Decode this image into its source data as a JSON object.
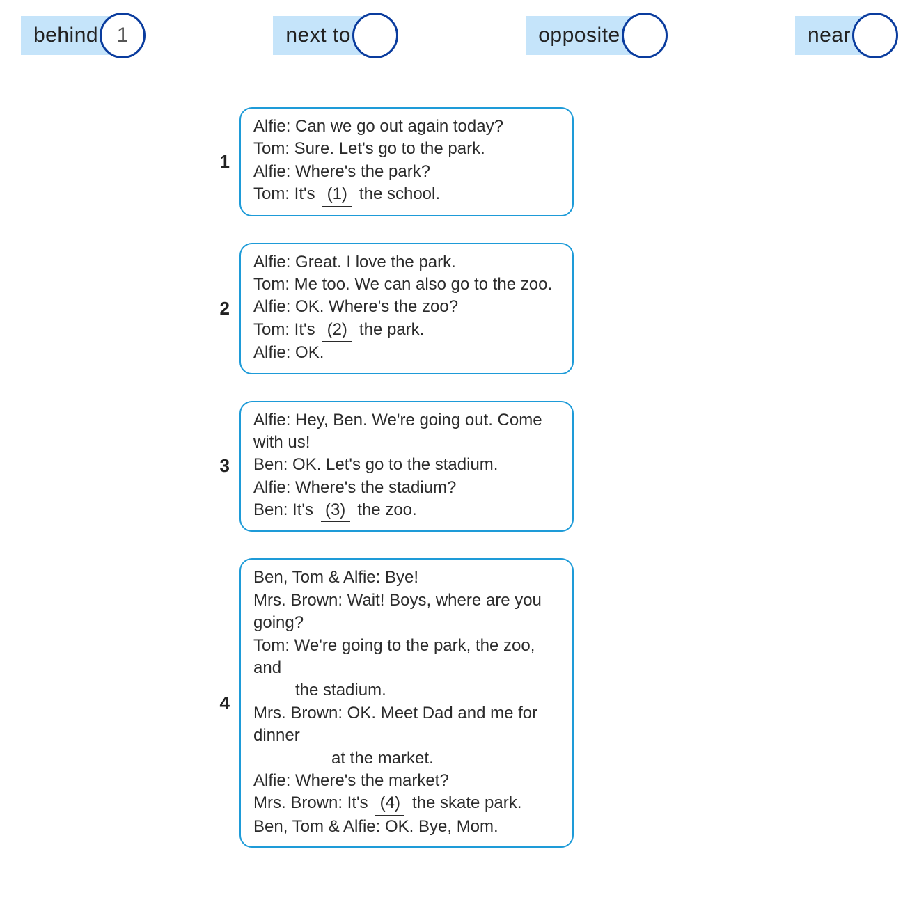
{
  "vocab": [
    {
      "label": "behind",
      "value": "1"
    },
    {
      "label": "next to",
      "value": ""
    },
    {
      "label": "opposite",
      "value": ""
    },
    {
      "label": "near",
      "value": ""
    }
  ],
  "dialogues": [
    {
      "num": "1",
      "lines": [
        {
          "t": "Alfie: Can we go out again today?"
        },
        {
          "t": "Tom: Sure. Let's go to the park."
        },
        {
          "t": "Alfie: Where's the park?"
        },
        {
          "pre": "Tom: It's ",
          "blank": "(1)",
          "post": " the school."
        }
      ]
    },
    {
      "num": "2",
      "lines": [
        {
          "t": "Alfie: Great. I love the park."
        },
        {
          "t": "Tom: Me too. We can also go to the zoo."
        },
        {
          "t": "Alfie: OK. Where's the zoo?"
        },
        {
          "pre": "Tom: It's ",
          "blank": "(2)",
          "post": " the park."
        },
        {
          "t": "Alfie: OK."
        }
      ]
    },
    {
      "num": "3",
      "lines": [
        {
          "t": "Alfie: Hey, Ben. We're going out. Come with us!"
        },
        {
          "t": "Ben: OK. Let's go to the stadium."
        },
        {
          "t": "Alfie: Where's the stadium?"
        },
        {
          "pre": "Ben: It's ",
          "blank": "(3)",
          "post": " the zoo."
        }
      ]
    },
    {
      "num": "4",
      "lines": [
        {
          "t": "Ben, Tom & Alfie: Bye!"
        },
        {
          "t": "Mrs. Brown: Wait! Boys, where are you going?"
        },
        {
          "t": "Tom: We're going to the park, the zoo, and"
        },
        {
          "t": "the stadium.",
          "cls": "indent"
        },
        {
          "t": "Mrs. Brown: OK. Meet Dad and me for dinner"
        },
        {
          "t": "at the market.",
          "cls": "indent2"
        },
        {
          "t": "Alfie: Where's the market?"
        },
        {
          "pre": "Mrs. Brown: It's ",
          "blank": "(4)",
          "post": " the skate park."
        },
        {
          "t": "Ben, Tom & Alfie: OK. Bye, Mom."
        }
      ]
    }
  ]
}
